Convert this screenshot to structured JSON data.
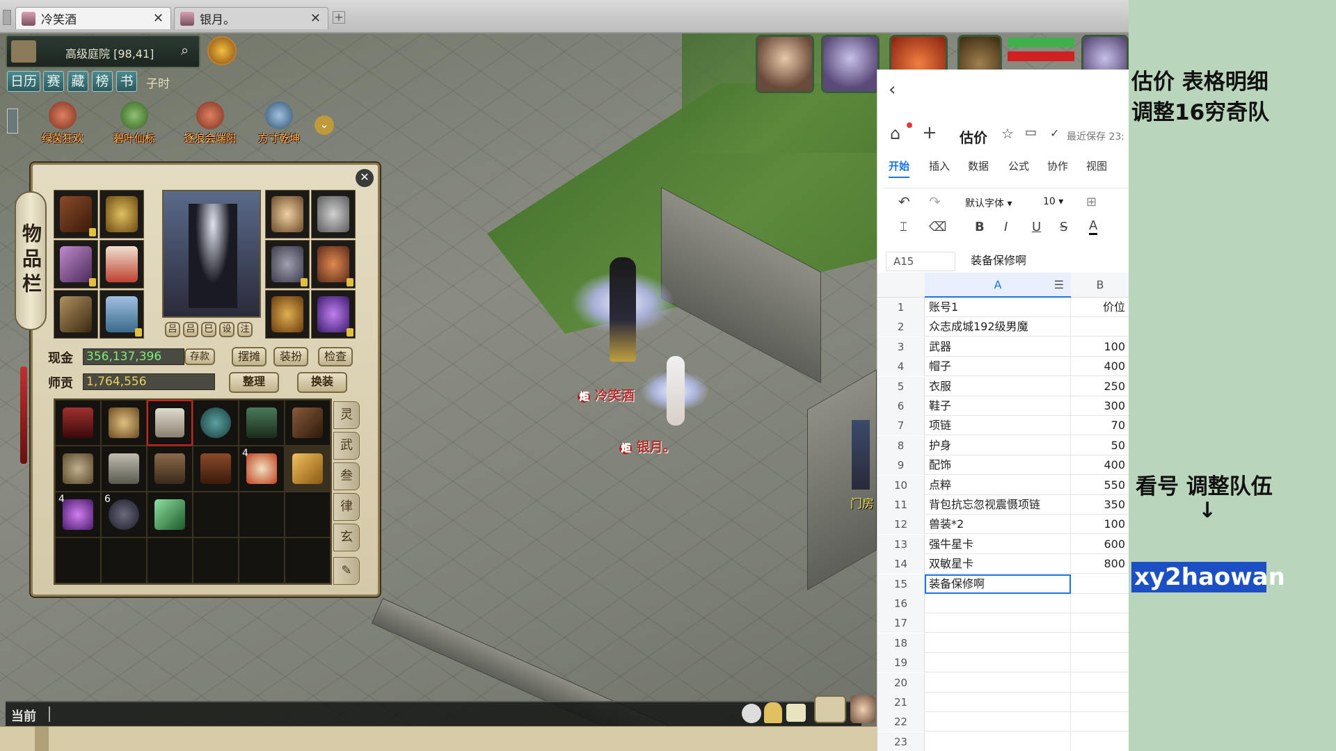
{
  "browser_tabs": [
    {
      "label": "冷笑酒"
    },
    {
      "label": "银月。"
    }
  ],
  "game": {
    "location": "高级庭院 [98,41]",
    "menu": [
      "日历",
      "赛",
      "藏",
      "榜",
      "书"
    ],
    "time": "子时",
    "activities": [
      "绿茵狂欢",
      "碧叶仙标",
      "逐浪会端阳",
      "方寸乾坤"
    ],
    "inventory": {
      "title": "物品栏",
      "cash_label": "现金",
      "cash_value": "356,137,396",
      "deposit_button": "存款",
      "tribute_label": "师贡",
      "tribute_value": "1,764,556",
      "buttons": [
        "摆摊",
        "装扮",
        "检查"
      ],
      "sort_button": "整理",
      "swap_button": "换装",
      "equip_tabs": [
        "吕",
        "吕",
        "巳",
        "设",
        "注"
      ],
      "side_tabs": [
        "灵",
        "武",
        "叁",
        "律",
        "玄"
      ],
      "stack_counts": [
        "4",
        "4",
        "6"
      ]
    },
    "characters": [
      {
        "name": "冷笑酒",
        "badge": "炬"
      },
      {
        "name": "银月。",
        "badge": "炬"
      }
    ],
    "npc_label": "门房",
    "chat_label": "当前"
  },
  "sheet": {
    "doc_title": "估价",
    "save_status": "最近保存 23:",
    "ribbon_tabs": [
      "开始",
      "插入",
      "数据",
      "公式",
      "协作",
      "视图"
    ],
    "font_name": "默认字体",
    "font_size": "10",
    "cell_ref": "A15",
    "formula": "装备保修啊",
    "col_a": "A",
    "col_b": "B",
    "rows": [
      {
        "n": "1",
        "a": "账号1",
        "b": "价位"
      },
      {
        "n": "2",
        "a": "众志成城192级男魔",
        "b": ""
      },
      {
        "n": "3",
        "a": "武器",
        "b": "100"
      },
      {
        "n": "4",
        "a": "帽子",
        "b": "400"
      },
      {
        "n": "5",
        "a": "衣服",
        "b": "250"
      },
      {
        "n": "6",
        "a": "鞋子",
        "b": "300"
      },
      {
        "n": "7",
        "a": "项链",
        "b": "70"
      },
      {
        "n": "8",
        "a": "护身",
        "b": "50"
      },
      {
        "n": "9",
        "a": "配饰",
        "b": "400"
      },
      {
        "n": "10",
        "a": "点粹",
        "b": "550"
      },
      {
        "n": "11",
        "a": "背包抗忘忽视震慑项链",
        "b": "350"
      },
      {
        "n": "12",
        "a": "兽装*2",
        "b": "100"
      },
      {
        "n": "13",
        "a": "强牛星卡",
        "b": "600"
      },
      {
        "n": "14",
        "a": "双敏星卡",
        "b": "800"
      },
      {
        "n": "15",
        "a": "装备保修啊",
        "b": ""
      },
      {
        "n": "16",
        "a": "",
        "b": ""
      },
      {
        "n": "17",
        "a": "",
        "b": ""
      },
      {
        "n": "18",
        "a": "",
        "b": ""
      },
      {
        "n": "19",
        "a": "",
        "b": ""
      },
      {
        "n": "20",
        "a": "",
        "b": ""
      },
      {
        "n": "21",
        "a": "",
        "b": ""
      },
      {
        "n": "22",
        "a": "",
        "b": ""
      },
      {
        "n": "23",
        "a": "",
        "b": ""
      }
    ]
  },
  "overlay": {
    "line1": "估价  表格明细",
    "line2": "调整16穷奇队",
    "line3": "看号 调整队伍",
    "arrow": "↓",
    "watermark": "xy2haowan"
  },
  "colors": {
    "accent_blue": "#1d4fc4",
    "side_green": "#b9d6bc",
    "cash_green": "#7cf07c",
    "tribute_gold": "#e8d060"
  }
}
